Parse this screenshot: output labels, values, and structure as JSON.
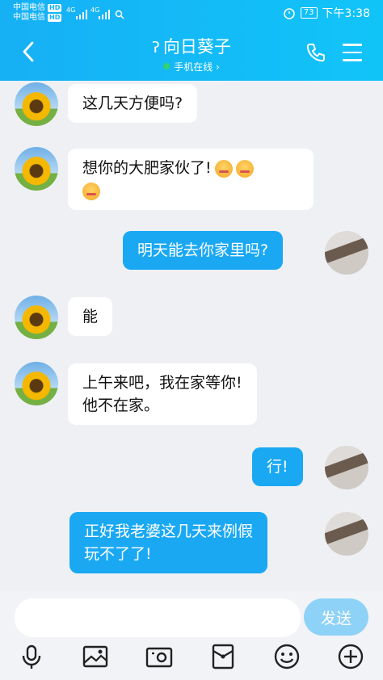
{
  "status_bar": {
    "carrier1": "中国电信",
    "carrier2": "中国电信",
    "hd": "HD",
    "network": "4G",
    "battery": "73",
    "time": "下午3:38"
  },
  "header": {
    "contact_name": "向日葵子",
    "presence": "手机在线 ›"
  },
  "messages": [
    {
      "side": "left",
      "text": "这几天方便吗?"
    },
    {
      "side": "left",
      "text": "想你的大肥家伙了!"
    },
    {
      "side": "right",
      "text": "明天能去你家里吗?"
    },
    {
      "side": "left",
      "text": "能"
    },
    {
      "side": "left",
      "line1": "上午来吧，我在家等你!",
      "line2": "他不在家。"
    },
    {
      "side": "right",
      "text": "行!"
    },
    {
      "side": "right",
      "line1": "正好我老婆这几天来例假",
      "line2": "玩不了了!"
    }
  ],
  "composer": {
    "placeholder": "",
    "send_label": "发送"
  },
  "toolbar": [
    "mic-icon",
    "image-icon",
    "camera-icon",
    "red-packet-icon",
    "emoji-icon",
    "plus-icon"
  ],
  "colors": {
    "header": "#16b0f5",
    "my_bubble": "#1aa8f3",
    "send_button": "#8ed2f7",
    "online_dot": "#2fd36a"
  }
}
